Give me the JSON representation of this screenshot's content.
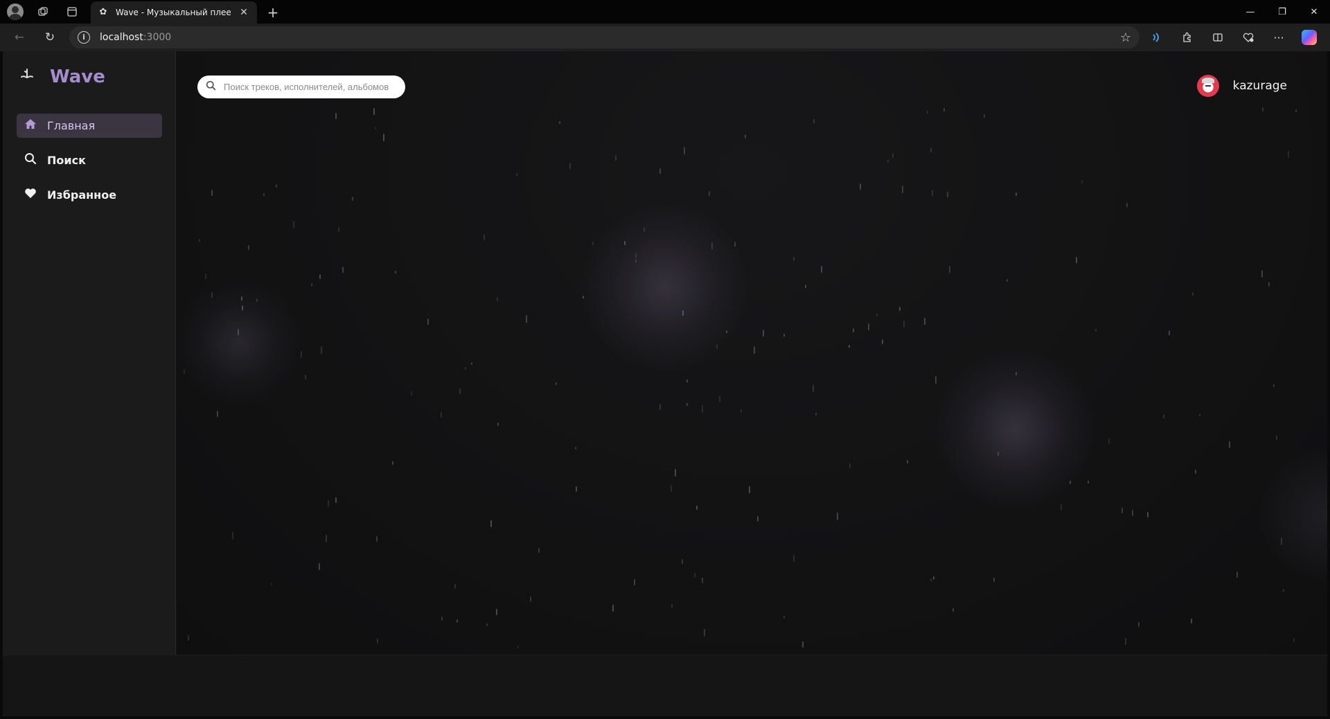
{
  "browser": {
    "tab": {
      "title": "Wave - Музыкальный плеер"
    },
    "address": {
      "host": "localhost",
      "port": ":3000"
    }
  },
  "app": {
    "brand": {
      "name": "Wave"
    },
    "sidebar": {
      "items": [
        {
          "label": "Главная",
          "icon": "home-icon",
          "active": true
        },
        {
          "label": "Поиск",
          "icon": "search-icon",
          "active": false
        },
        {
          "label": "Избранное",
          "icon": "heart-icon",
          "active": false
        }
      ]
    },
    "search": {
      "placeholder": "Поиск треков, исполнителей, альбомов"
    },
    "user": {
      "name": "kazurage"
    },
    "colors": {
      "accent": "#a58ccf",
      "background": "#111112",
      "sidebar": "#1b1b1c"
    }
  }
}
